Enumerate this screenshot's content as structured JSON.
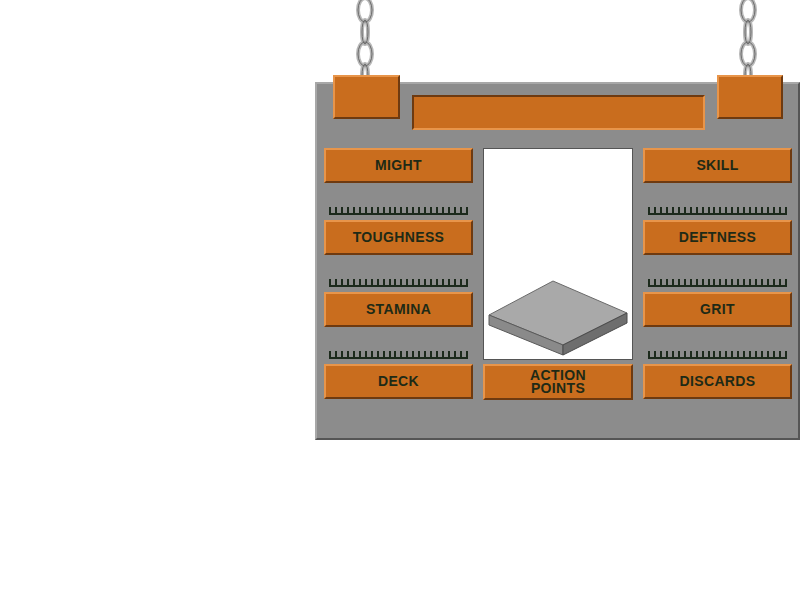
{
  "left_column": [
    {
      "label": "MIGHT",
      "kind": "stat"
    },
    {
      "label": "TOUGHNESS",
      "kind": "stat"
    },
    {
      "label": "STAMINA",
      "kind": "stat"
    },
    {
      "label": "DECK",
      "kind": "pile"
    }
  ],
  "right_column": [
    {
      "label": "SKILL",
      "kind": "stat"
    },
    {
      "label": "DEFTNESS",
      "kind": "stat"
    },
    {
      "label": "GRIT",
      "kind": "stat"
    },
    {
      "label": "DISCARDS",
      "kind": "pile"
    }
  ],
  "action_points": {
    "label": "ACTION POINTS"
  }
}
